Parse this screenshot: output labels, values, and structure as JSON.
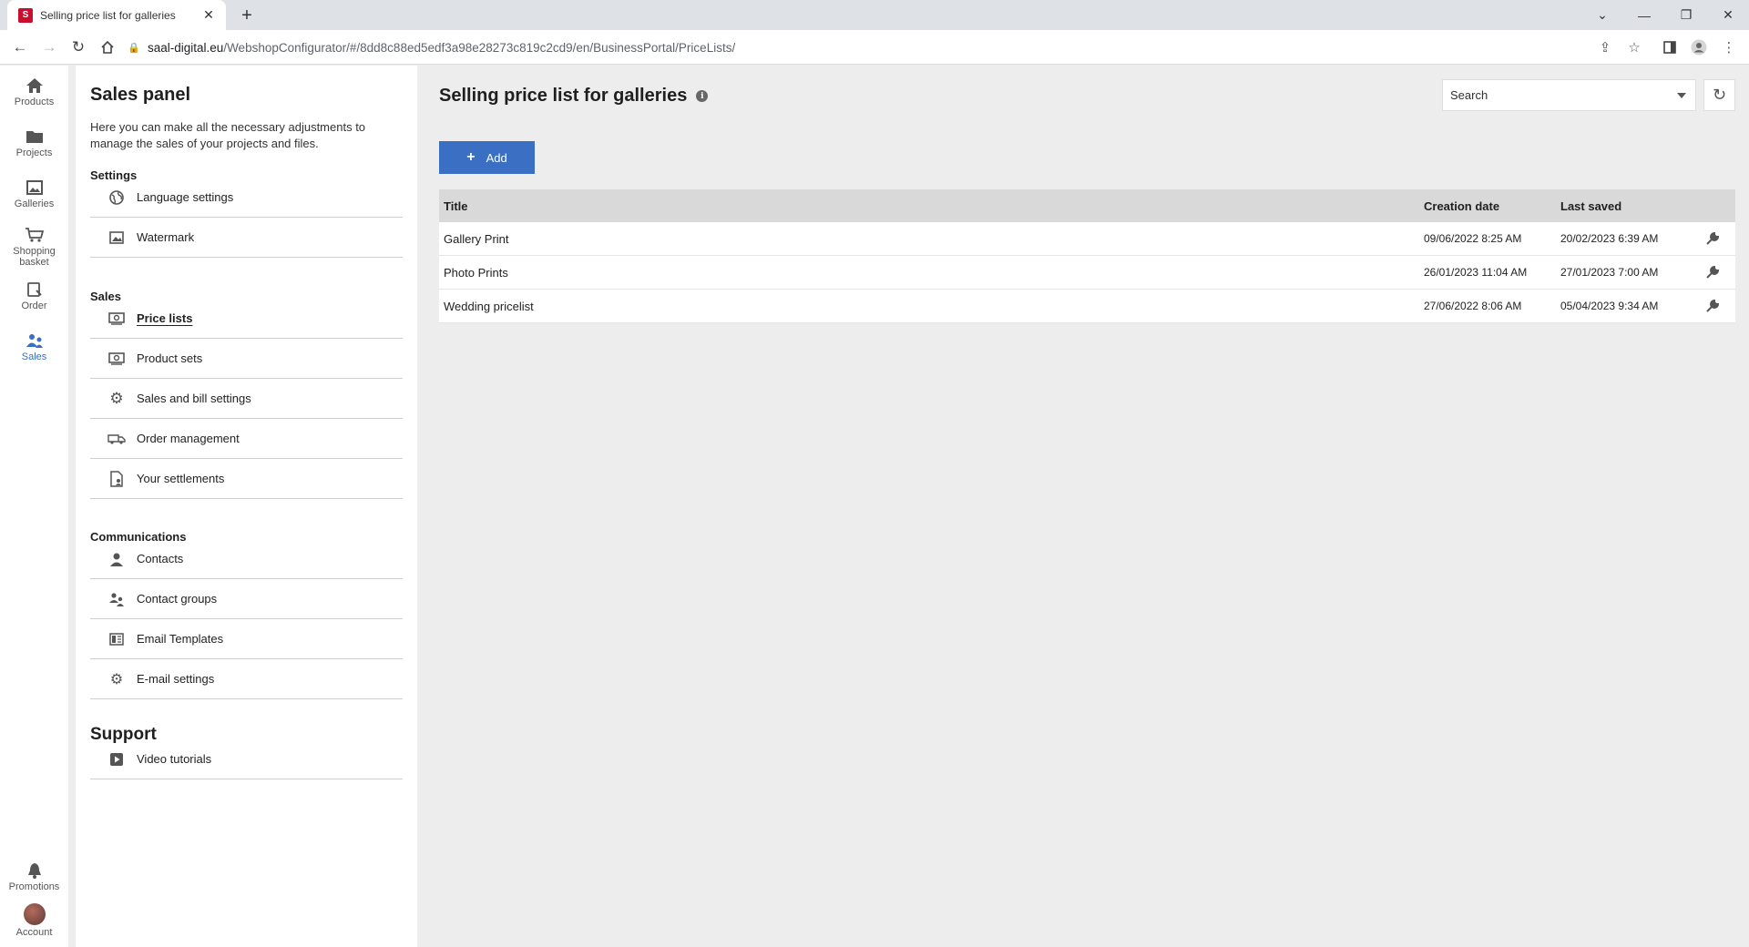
{
  "browser": {
    "tab_title": "Selling price list for galleries",
    "favicon_letter": "S",
    "new_tab_symbol": "+",
    "url_host": "saal-digital.eu",
    "url_path": "/WebshopConfigurator/#/8dd8c88ed5edf3a98e28273c819c2cd9/en/BusinessPortal/PriceLists/"
  },
  "rail": {
    "items": [
      {
        "label": "Products",
        "icon": "home-icon"
      },
      {
        "label": "Projects",
        "icon": "folder-icon"
      },
      {
        "label": "Galleries",
        "icon": "gallery-icon"
      },
      {
        "label": "Shopping basket",
        "icon": "cart-icon"
      },
      {
        "label": "Order",
        "icon": "order-icon"
      },
      {
        "label": "Sales",
        "icon": "sales-icon",
        "active": true
      }
    ],
    "bottom": [
      {
        "label": "Promotions",
        "icon": "bell-icon"
      },
      {
        "label": "Account",
        "icon": "avatar"
      }
    ]
  },
  "panel": {
    "title": "Sales panel",
    "description": "Here you can make all the necessary adjustments to manage the sales of your projects and files.",
    "settings_heading": "Settings",
    "settings_items": [
      "Language settings",
      "Watermark"
    ],
    "sales_heading": "Sales",
    "sales_items": [
      "Price lists",
      "Product sets",
      "Sales and bill settings",
      "Order management",
      "Your settlements"
    ],
    "comms_heading": "Communications",
    "comms_items": [
      "Contacts",
      "Contact groups",
      "Email Templates",
      "E-mail settings"
    ],
    "support_heading": "Support",
    "support_items": [
      "Video tutorials"
    ]
  },
  "main": {
    "title": "Selling price list for galleries",
    "search_placeholder": "Search",
    "add_label": "Add",
    "columns": {
      "title": "Title",
      "created": "Creation date",
      "saved": "Last saved"
    },
    "rows": [
      {
        "title": "Gallery Print",
        "created": "09/06/2022 8:25 AM",
        "saved": "20/02/2023 6:39 AM"
      },
      {
        "title": "Photo Prints",
        "created": "26/01/2023 11:04 AM",
        "saved": "27/01/2023 7:00 AM"
      },
      {
        "title": "Wedding pricelist",
        "created": "27/06/2022 8:06 AM",
        "saved": "05/04/2023 9:34 AM"
      }
    ]
  },
  "colors": {
    "accent": "#3a6fc4",
    "brand": "#c8102e"
  }
}
